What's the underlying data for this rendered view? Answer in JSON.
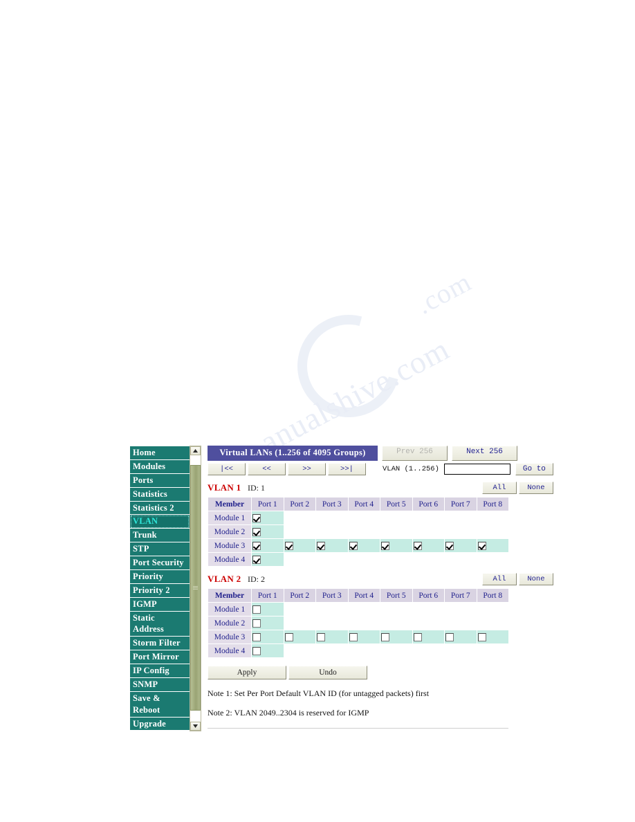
{
  "watermark": {
    "line1": "anualshive.com",
    "line2": ".com"
  },
  "sidebar": {
    "items": [
      {
        "label": "Home",
        "name": "home",
        "selected": false
      },
      {
        "label": "Modules",
        "name": "modules",
        "selected": false
      },
      {
        "label": "Ports",
        "name": "ports",
        "selected": false
      },
      {
        "label": "Statistics",
        "name": "statistics",
        "selected": false
      },
      {
        "label": "Statistics 2",
        "name": "statistics-2",
        "selected": false
      },
      {
        "label": "VLAN",
        "name": "vlan",
        "selected": true
      },
      {
        "label": "Trunk",
        "name": "trunk",
        "selected": false
      },
      {
        "label": "STP",
        "name": "stp",
        "selected": false
      },
      {
        "label": "Port Security",
        "name": "port-security",
        "selected": false
      },
      {
        "label": "Priority",
        "name": "priority",
        "selected": false
      },
      {
        "label": "Priority 2",
        "name": "priority-2",
        "selected": false
      },
      {
        "label": "IGMP",
        "name": "igmp",
        "selected": false
      },
      {
        "label": "Static Address",
        "name": "static-address",
        "selected": false
      },
      {
        "label": "Storm Filter",
        "name": "storm-filter",
        "selected": false
      },
      {
        "label": "Port Mirror",
        "name": "port-mirror",
        "selected": false
      },
      {
        "label": "IP Config",
        "name": "ip-config",
        "selected": false
      },
      {
        "label": "SNMP",
        "name": "snmp",
        "selected": false
      },
      {
        "label": "Save & Reboot",
        "name": "save-reboot",
        "selected": false
      },
      {
        "label": "Upgrade",
        "name": "upgrade",
        "selected": false
      }
    ],
    "accent_color": "#1b7a71",
    "selected_color": "#30e8dc"
  },
  "header": {
    "title": "Virtual LANs (1..256 of 4095 Groups)",
    "prev_label": "Prev 256",
    "next_label": "Next 256",
    "prev_enabled": false,
    "next_enabled": true,
    "title_bg": "#4f4f9e"
  },
  "navigation": {
    "first_label": "|<<",
    "back_label": "<<",
    "forward_label": ">>",
    "last_label": ">>|",
    "goto_field_label": "VLAN (1..256)",
    "goto_field_value": "",
    "goto_field_placeholder": "",
    "goto_button_label": "Go to"
  },
  "table_common": {
    "member_header": "Member",
    "port_headers": [
      "Port 1",
      "Port 2",
      "Port 3",
      "Port 4",
      "Port 5",
      "Port 6",
      "Port 7",
      "Port 8"
    ],
    "module_labels": [
      "Module 1",
      "Module 2",
      "Module 3",
      "Module 4"
    ],
    "all_label": "All",
    "none_label": "None"
  },
  "vlans": [
    {
      "name": "VLAN 1",
      "id_text": "ID: 1",
      "rows": [
        {
          "module": "Module 1",
          "cells": [
            {
              "active": true,
              "checked": true
            },
            {
              "active": false,
              "checked": null
            },
            {
              "active": false,
              "checked": null
            },
            {
              "active": false,
              "checked": null
            },
            {
              "active": false,
              "checked": null
            },
            {
              "active": false,
              "checked": null
            },
            {
              "active": false,
              "checked": null
            },
            {
              "active": false,
              "checked": null
            }
          ]
        },
        {
          "module": "Module 2",
          "cells": [
            {
              "active": true,
              "checked": true
            },
            {
              "active": false,
              "checked": null
            },
            {
              "active": false,
              "checked": null
            },
            {
              "active": false,
              "checked": null
            },
            {
              "active": false,
              "checked": null
            },
            {
              "active": false,
              "checked": null
            },
            {
              "active": false,
              "checked": null
            },
            {
              "active": false,
              "checked": null
            }
          ]
        },
        {
          "module": "Module 3",
          "cells": [
            {
              "active": true,
              "checked": true
            },
            {
              "active": true,
              "checked": true
            },
            {
              "active": true,
              "checked": true
            },
            {
              "active": true,
              "checked": true
            },
            {
              "active": true,
              "checked": true
            },
            {
              "active": true,
              "checked": true
            },
            {
              "active": true,
              "checked": true
            },
            {
              "active": true,
              "checked": true
            }
          ]
        },
        {
          "module": "Module 4",
          "cells": [
            {
              "active": true,
              "checked": true
            },
            {
              "active": false,
              "checked": null
            },
            {
              "active": false,
              "checked": null
            },
            {
              "active": false,
              "checked": null
            },
            {
              "active": false,
              "checked": null
            },
            {
              "active": false,
              "checked": null
            },
            {
              "active": false,
              "checked": null
            },
            {
              "active": false,
              "checked": null
            }
          ]
        }
      ]
    },
    {
      "name": "VLAN 2",
      "id_text": "ID: 2",
      "rows": [
        {
          "module": "Module 1",
          "cells": [
            {
              "active": true,
              "checked": false
            },
            {
              "active": false,
              "checked": null
            },
            {
              "active": false,
              "checked": null
            },
            {
              "active": false,
              "checked": null
            },
            {
              "active": false,
              "checked": null
            },
            {
              "active": false,
              "checked": null
            },
            {
              "active": false,
              "checked": null
            },
            {
              "active": false,
              "checked": null
            }
          ]
        },
        {
          "module": "Module 2",
          "cells": [
            {
              "active": true,
              "checked": false
            },
            {
              "active": false,
              "checked": null
            },
            {
              "active": false,
              "checked": null
            },
            {
              "active": false,
              "checked": null
            },
            {
              "active": false,
              "checked": null
            },
            {
              "active": false,
              "checked": null
            },
            {
              "active": false,
              "checked": null
            },
            {
              "active": false,
              "checked": null
            }
          ]
        },
        {
          "module": "Module 3",
          "cells": [
            {
              "active": true,
              "checked": false
            },
            {
              "active": true,
              "checked": false
            },
            {
              "active": true,
              "checked": false
            },
            {
              "active": true,
              "checked": false
            },
            {
              "active": true,
              "checked": false
            },
            {
              "active": true,
              "checked": false
            },
            {
              "active": true,
              "checked": false
            },
            {
              "active": true,
              "checked": false
            }
          ]
        },
        {
          "module": "Module 4",
          "cells": [
            {
              "active": true,
              "checked": false
            },
            {
              "active": false,
              "checked": null
            },
            {
              "active": false,
              "checked": null
            },
            {
              "active": false,
              "checked": null
            },
            {
              "active": false,
              "checked": null
            },
            {
              "active": false,
              "checked": null
            },
            {
              "active": false,
              "checked": null
            },
            {
              "active": false,
              "checked": null
            }
          ]
        }
      ]
    }
  ],
  "actions": {
    "apply_label": "Apply",
    "undo_label": "Undo"
  },
  "notes": [
    "Note 1: Set Per Port Default VLAN ID (for untagged packets) first",
    "Note 2: VLAN 2049..2304 is reserved for IGMP"
  ]
}
